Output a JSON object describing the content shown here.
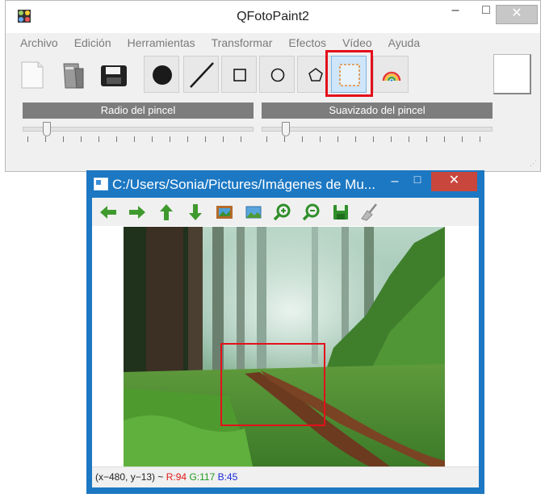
{
  "main_window": {
    "title": "QFotoPaint2",
    "menu": [
      "Archivo",
      "Edición",
      "Herramientas",
      "Transformar",
      "Efectos",
      "Vídeo",
      "Ayuda"
    ],
    "tools": {
      "file_tools": [
        "new-file-icon",
        "open-file-icon",
        "save-file-icon"
      ],
      "paint_tools": [
        "dot-brush-icon",
        "line-icon",
        "rectangle-icon",
        "ellipse-icon",
        "polygon-icon",
        "selection-icon",
        "rainbow-icon"
      ],
      "selected_tool": "selection-icon"
    },
    "current_color": "#ffffff",
    "sliders": {
      "brush_radius_label": "Radio del pincel",
      "brush_smoothing_label": "Suavizado del pincel"
    },
    "colors": {
      "highlight": "#e3101b"
    }
  },
  "image_window": {
    "title": "C:/Users/Sonia/Pictures/Imágenes de Mu...",
    "toolbar_icons": [
      "arrow-left-icon",
      "arrow-right-icon",
      "arrow-up-icon",
      "arrow-down-icon",
      "image-icon",
      "landscape-icon",
      "zoom-in-icon",
      "zoom-out-icon",
      "save-icon",
      "broom-icon"
    ],
    "status": {
      "coords": "(x−480, y−13) ~ ",
      "r": "R:94",
      "g": "G:117",
      "b": "B:45"
    },
    "colors": {
      "frame": "#1c78c3",
      "close": "#c9463d",
      "selection": "#e3101b"
    }
  }
}
